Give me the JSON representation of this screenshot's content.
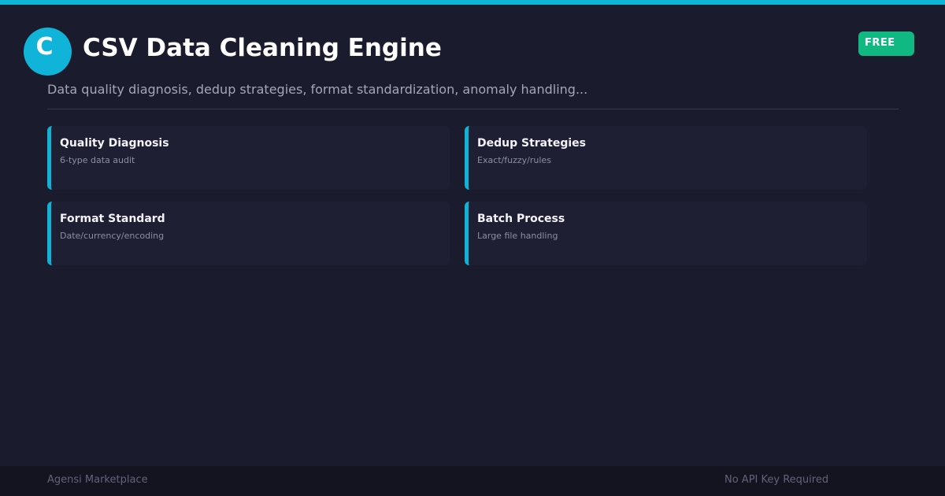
{
  "header": {
    "logo_letter": "C",
    "title": "CSV Data Cleaning Engine",
    "badge": "FREE",
    "subtitle": "Data quality diagnosis, dedup strategies, format standardization, anomaly handling..."
  },
  "features": [
    {
      "title": "Quality Diagnosis",
      "description": "6-type data audit"
    },
    {
      "title": "Dedup Strategies",
      "description": "Exact/fuzzy/rules"
    },
    {
      "title": "Format Standard",
      "description": "Date/currency/encoding"
    },
    {
      "title": "Batch Process",
      "description": "Large file handling"
    }
  ],
  "footer": {
    "left": "Agensi Marketplace",
    "right": "No API Key Required"
  },
  "colors": {
    "background": "#1b1b2e",
    "accent": "#0fb3d6",
    "badge": "#10b981",
    "card": "#1f1f33",
    "footer": "#141421"
  }
}
